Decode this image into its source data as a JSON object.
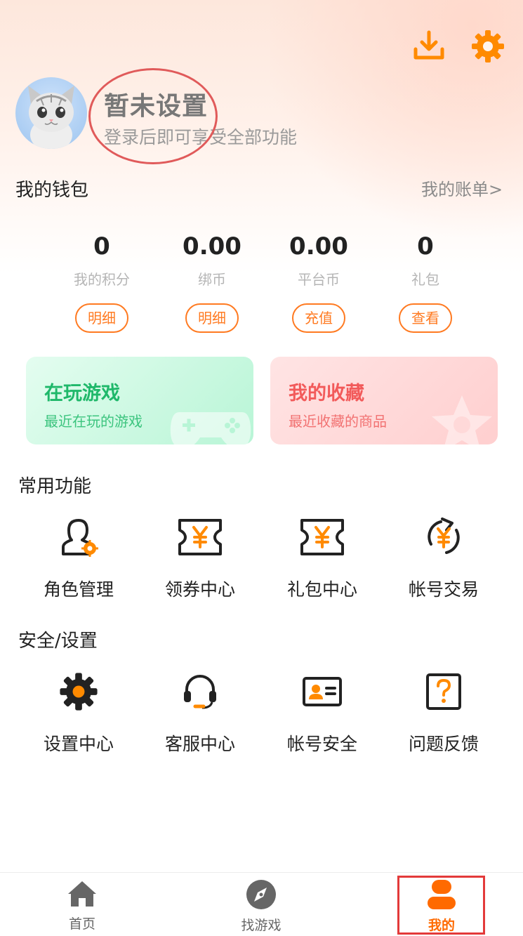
{
  "header": {
    "download_icon": "download-icon",
    "settings_icon": "gear-icon"
  },
  "profile": {
    "name": "暂未设置",
    "subtitle": "登录后即可享受全部功能"
  },
  "wallet": {
    "title": "我的钱包",
    "bill_link": "我的账单>",
    "items": [
      {
        "value": "0",
        "label": "我的积分",
        "button": "明细"
      },
      {
        "value": "0.00",
        "label": "绑币",
        "button": "明细"
      },
      {
        "value": "0.00",
        "label": "平台币",
        "button": "充值"
      },
      {
        "value": "0",
        "label": "礼包",
        "button": "查看"
      }
    ]
  },
  "cards": [
    {
      "title": "在玩游戏",
      "subtitle": "最近在玩的游戏"
    },
    {
      "title": "我的收藏",
      "subtitle": "最近收藏的商品"
    }
  ],
  "common": {
    "title": "常用功能",
    "items": [
      {
        "label": "角色管理",
        "icon": "role-manage-icon"
      },
      {
        "label": "领券中心",
        "icon": "coupon-icon"
      },
      {
        "label": "礼包中心",
        "icon": "gift-coupon-icon"
      },
      {
        "label": "帐号交易",
        "icon": "account-trade-icon"
      }
    ]
  },
  "security": {
    "title": "安全/设置",
    "items": [
      {
        "label": "设置中心",
        "icon": "gear-icon"
      },
      {
        "label": "客服中心",
        "icon": "headset-icon"
      },
      {
        "label": "帐号安全",
        "icon": "id-card-icon"
      },
      {
        "label": "问题反馈",
        "icon": "question-icon"
      }
    ]
  },
  "nav": {
    "items": [
      {
        "label": "首页",
        "icon": "home-icon"
      },
      {
        "label": "找游戏",
        "icon": "compass-icon"
      },
      {
        "label": "我的",
        "icon": "user-icon",
        "active": true
      }
    ]
  },
  "colors": {
    "accent": "#ff7a21",
    "annotation": "#e33a3a"
  }
}
